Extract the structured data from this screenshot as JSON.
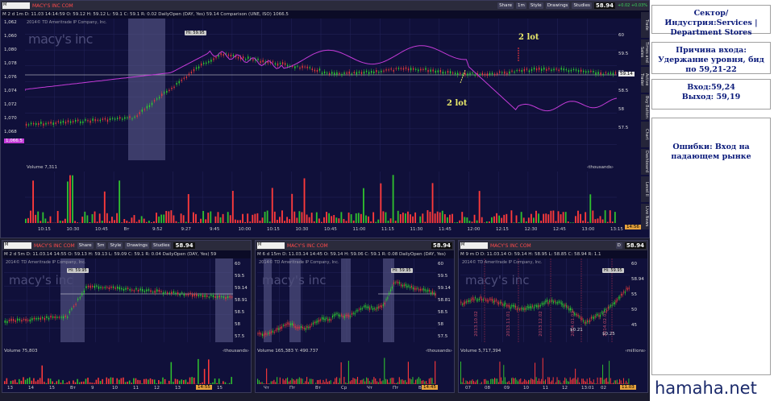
{
  "main": {
    "symbol": "M",
    "company": "MACY'S INC COM",
    "share": "Share",
    "interval": "1m",
    "style": "Style",
    "drawings": "Drawings",
    "studies": "Studies",
    "price": "58.94",
    "change": "+0.02 +0.03%",
    "info": "M 2 d 1m  D: 11.03 14:14:59  O: 59.12  H: 59.12  L: 59.1  C: 59.1  R: 0.02  DailyOpen (DAY, Yes)  59.14  Comparison (UNE, ISO)  1066.5",
    "copyright": "2014© TD Ameritrade IP Company, Inc.",
    "logo": "macy's inc",
    "hi_label": "Hi: 59.95",
    "y_labels_left": [
      "1,062",
      "1,060",
      "1,080",
      "1,078",
      "1,076",
      "1,074",
      "1,072",
      "1,070",
      "1,068",
      "1,066.5"
    ],
    "y_labels_right": [
      "60",
      "59.5",
      "59.14",
      "59",
      "58.5",
      "58",
      "57.5"
    ],
    "volume_label": "Volume  7,311",
    "volume_units": "‹thousands›",
    "vol_y": [
      "100",
      "50"
    ],
    "x_labels": [
      "10:15",
      "10:30",
      "10:45",
      "Вт",
      "9:52",
      "9:27",
      "9:45",
      "10:00",
      "10:15",
      "10:30",
      "10:45",
      "11:00",
      "11:15",
      "11:30",
      "11:45",
      "12:00",
      "12:15",
      "12:30",
      "12:45",
      "13:00",
      "13:15"
    ],
    "time_now": "14:56",
    "annotation_a": "2 lot",
    "annotation_b": "2 lot",
    "side_tabs": [
      "Trade",
      "Times and Sales",
      "Active Trader",
      "Buy Button",
      "Chart",
      "Dashboard",
      "Level II",
      "Live News"
    ]
  },
  "chart2": {
    "symbol": "M",
    "company": "MACY'S INC COM",
    "interval": "5m",
    "price": "58.94",
    "info": "M 2 d 5m  D: 11.03.14 14:55  O: 59.13  H: 59.13  L: 59.09  C: 59.1  R: 0.04  DailyOpen (DAY, Yes)  59",
    "copyright": "2014© TD Ameritrade IP Company, Inc.",
    "logo": "macy's inc",
    "hi_label": "Hi: 59.95",
    "y_labels": [
      "60",
      "59.5",
      "59.14",
      "58.91",
      "58.5",
      "58",
      "57.5"
    ],
    "volume_label": "Volume  75,803",
    "volume_units": "‹thousands›",
    "vol_y": [
      "400",
      "200"
    ],
    "x_labels": [
      "13",
      "14",
      "15",
      "Вт",
      "9",
      "10",
      "11",
      "12",
      "13",
      "14",
      "15"
    ],
    "time_now": "14:55"
  },
  "chart3": {
    "symbol": "M",
    "company": "MACY'S INC COM",
    "interval": "15m",
    "price": "58.94",
    "info": "M 6 d 15m  D: 11.03.14 14:45  O: 59.14  H: 59.06  C: 59.1  R: 0.08  DailyOpen (DAY, Yes)",
    "copyright": "2014© TD Ameritrade IP Company, Inc.",
    "logo": "macy's inc",
    "hi_label": "Hi: 59.95",
    "y_labels": [
      "60",
      "59.5",
      "59.14",
      "58.81",
      "58.5",
      "58",
      "57.5"
    ],
    "volume_label": "Volume  165,383  Y: 490.737",
    "volume_units": "‹thousands›",
    "vol_y": [
      "490.737",
      "400",
      "200"
    ],
    "x_labels": [
      "Чт",
      "Пт",
      "Вт",
      "Ср",
      "Чт",
      "Пт",
      "Вт"
    ],
    "time_now": "14:45"
  },
  "chart4": {
    "symbol": "M",
    "company": "MACY'S INC COM",
    "interval": "D",
    "price": "58.94",
    "info": "M 9 m D  D: 11.03.14  O: 59.14  H: 58.95  L: 58.85  C: 58.94  R: 1.1",
    "copyright": "2014© TD Ameritrade IP Company, Inc.",
    "logo": "macy's inc",
    "hi_label": "Hi: 59.95",
    "y_labels": [
      "60",
      "58.94",
      "55",
      "50",
      "45"
    ],
    "volume_label": "Volume  5,717,394",
    "volume_units": "‹millions›",
    "vol_y": [
      "20",
      "10"
    ],
    "x_labels": [
      "07",
      "08",
      "09",
      "10",
      "11",
      "12",
      "13:01",
      "02",
      "03"
    ],
    "rotated_dates": [
      "2013.10.02",
      "2013.11.01",
      "2013.12.02",
      "2014.01.02",
      "2014.02.03"
    ],
    "events": [
      "$0.21",
      "$0.25"
    ],
    "time_now": "11.03"
  },
  "side": {
    "box1": "Сектор/Индустрия:Services | Department Stores",
    "box2": "Причина входа: Удержание уровня, бид по 59,21-22",
    "box3": "Вход:59,24\nВыход: 59,19",
    "box4": "Ошибки: Вход на падающем рынке",
    "watermark": "hamaha.net"
  },
  "colors": {
    "bg": "#10103a",
    "candle_up": "#2fd12f",
    "candle_down": "#e83b3b",
    "comparison": "#c43bd8",
    "level": "#e8e8e8",
    "volume": "#ff3a3a",
    "volume_up": "#2fbf2f",
    "highlight": "#5a5a8a",
    "accent": "#0a1a7a"
  }
}
